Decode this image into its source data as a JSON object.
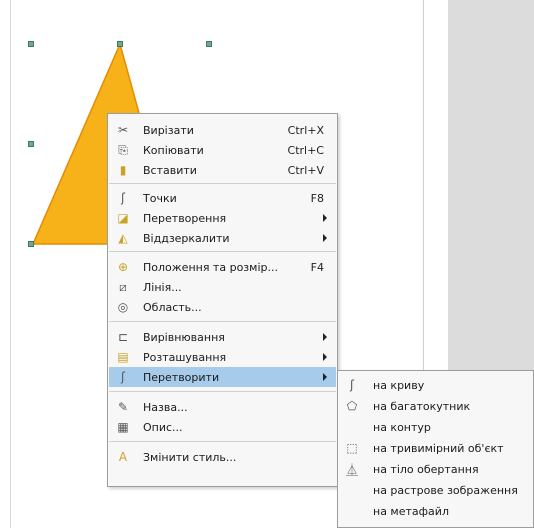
{
  "context_menu": {
    "items": [
      {
        "label": "Вирізати",
        "shortcut": "Ctrl+X",
        "icon": "cut-icon"
      },
      {
        "label": "Копіювати",
        "shortcut": "Ctrl+C",
        "icon": "copy-icon"
      },
      {
        "label": "Вставити",
        "shortcut": "Ctrl+V",
        "icon": "paste-icon"
      },
      {
        "label": "Точки",
        "shortcut": "F8",
        "icon": "points-icon"
      },
      {
        "label": "Перетворення",
        "shortcut": "",
        "icon": "transform-icon"
      },
      {
        "label": "Віддзеркалити",
        "shortcut": "",
        "icon": "flip-icon"
      },
      {
        "label": "Положення та розмір...",
        "shortcut": "F4",
        "icon": "position-size-icon"
      },
      {
        "label": "Лінія...",
        "shortcut": "",
        "icon": "line-icon"
      },
      {
        "label": "Область...",
        "shortcut": "",
        "icon": "area-icon"
      },
      {
        "label": "Вирівнювання",
        "shortcut": "",
        "icon": "align-icon"
      },
      {
        "label": "Розташування",
        "shortcut": "",
        "icon": "arrange-icon"
      },
      {
        "label": "Перетворити",
        "shortcut": "",
        "icon": "convert-icon"
      },
      {
        "label": "Назва...",
        "shortcut": "",
        "icon": "name-icon"
      },
      {
        "label": "Опис...",
        "shortcut": "",
        "icon": "description-icon"
      },
      {
        "label": "Змінити стиль...",
        "shortcut": "",
        "icon": "edit-style-icon"
      }
    ]
  },
  "convert_submenu": {
    "items": [
      {
        "label": "на криву",
        "icon": "to-curve-icon"
      },
      {
        "label": "на багатокутник",
        "icon": "to-polygon-icon"
      },
      {
        "label": "на контур",
        "icon": ""
      },
      {
        "label": "на тривимірний об'єкт",
        "icon": "to-3d-icon"
      },
      {
        "label": "на тіло обертання",
        "icon": "to-rotation-object-icon"
      },
      {
        "label": "на растрове зображення",
        "icon": ""
      },
      {
        "label": "на метафайл",
        "icon": ""
      }
    ]
  },
  "colors": {
    "shape_fill": "#f7b21a",
    "shape_stroke": "#e68a00",
    "highlight": "#a7cbea",
    "handle": "#6fa98e",
    "workspace": "#dcdcdc"
  }
}
